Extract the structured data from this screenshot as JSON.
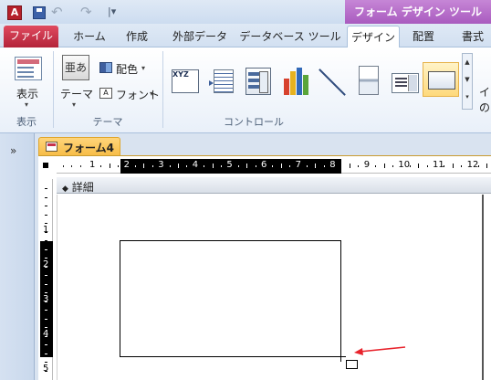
{
  "app": {
    "icon_letter": "A",
    "contextual_tab_title": "フォーム デザイン ツール"
  },
  "qat": {
    "separator_glyph": "|▾",
    "undo_glyph": "↶",
    "redo_glyph": "↷"
  },
  "tabs": [
    {
      "label": "ファイル"
    },
    {
      "label": "ホーム"
    },
    {
      "label": "作成"
    },
    {
      "label": "外部データ"
    },
    {
      "label": "データベース ツール"
    },
    {
      "label": "デザイン"
    },
    {
      "label": "配置"
    },
    {
      "label": "書式"
    }
  ],
  "ribbon": {
    "view": {
      "button_label": "表示",
      "group_label": "表示"
    },
    "theme": {
      "button_label": "テーマ",
      "icon_glyph": "亜あ",
      "colors_label": "配色",
      "fonts_label": "フォント",
      "group_label": "テーマ"
    },
    "controls": {
      "textbox_glyph": "XYZ",
      "group_label": "コントロール"
    },
    "insert_partial_label": "イの"
  },
  "navpane": {
    "toggle_glyph": "»"
  },
  "document": {
    "tab_label": "フォーム4",
    "section_label": "詳細",
    "section_marker": "◆"
  },
  "ruler": {
    "horizontal_labels": [
      "1",
      "2",
      "3",
      "4",
      "5",
      "6",
      "7",
      "8",
      "9",
      "10",
      "11",
      "12"
    ],
    "vertical_labels": [
      "1",
      "2",
      "3",
      "4",
      "5"
    ]
  },
  "colors": {
    "file_tab": "#c1304a",
    "contextual": "#b46ac6",
    "annotation_arrow": "#e8232c",
    "doc_tab": "#f7bd48"
  }
}
